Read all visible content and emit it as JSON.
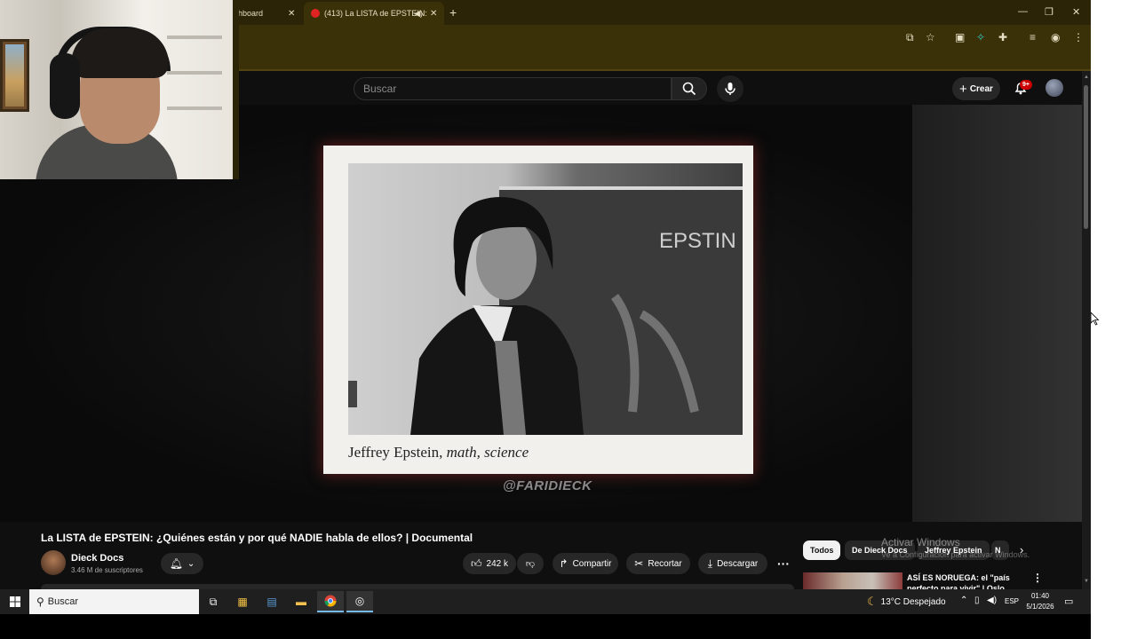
{
  "browser": {
    "tabs": [
      {
        "title": "hboard",
        "active": false
      },
      {
        "title": "(413) La LISTA de EPSTEIN:",
        "active": true
      }
    ],
    "new_tab_label": "+",
    "window_controls": {
      "minimize": "—",
      "restore": "❐",
      "close": "✕"
    },
    "accent_color": "#2b2406"
  },
  "youtube": {
    "search": {
      "placeholder": "Buscar",
      "value": ""
    },
    "create_label": "Crear",
    "notifications_badge": "9+",
    "watermark": "@FARIDIECK",
    "photo_caption": {
      "name": "Jeffrey Epstein,",
      "subjects": "math, science"
    },
    "chalkboard_text": "EPSTIN",
    "video": {
      "title": "La LISTA de EPSTEIN: ¿Quiénes están y por qué NADIE habla de ellos? | Documental",
      "channel": "Dieck Docs",
      "subscribers": "3.46 M de suscriptores",
      "likes": "242 k",
      "share_label": "Compartir",
      "clip_label": "Recortar",
      "download_label": "Descargar"
    },
    "chips": [
      "Todos",
      "De Dieck Docs",
      "Jeffrey Epstein",
      "N"
    ],
    "recommendation": {
      "title": "ASÍ ES NORUEGA: el \"país perfecto para vivir\" | Oslo ve..."
    }
  },
  "windows_activation": {
    "title": "Activar Windows",
    "subtitle": "Ve a Configuración para activar Windows."
  },
  "taskbar": {
    "search_placeholder": "Buscar",
    "weather": "13°C  Despejado",
    "language": "ESP",
    "time": "01:40",
    "date": "5/1/2026"
  }
}
